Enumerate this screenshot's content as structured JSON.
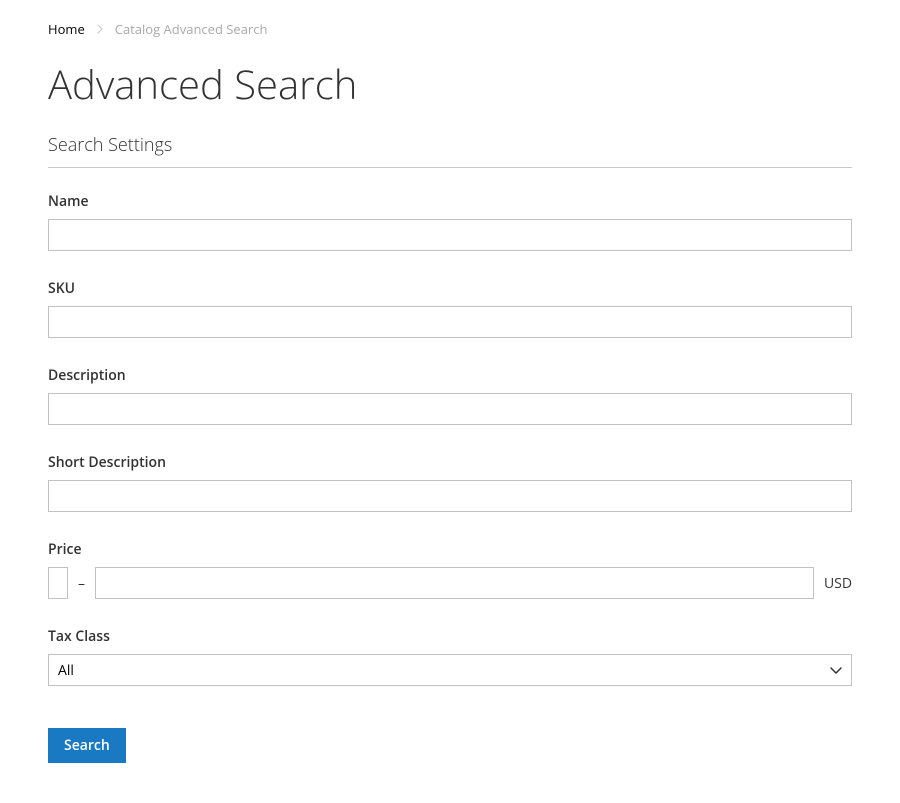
{
  "breadcrumbs": {
    "home": "Home",
    "current": "Catalog Advanced Search"
  },
  "page_title": "Advanced Search",
  "legend": "Search Settings",
  "fields": {
    "name": {
      "label": "Name",
      "value": ""
    },
    "sku": {
      "label": "SKU",
      "value": ""
    },
    "description": {
      "label": "Description",
      "value": ""
    },
    "short_description": {
      "label": "Short Description",
      "value": ""
    },
    "price": {
      "label": "Price",
      "from": "",
      "to": "",
      "separator": "–",
      "currency": "USD"
    },
    "tax_class": {
      "label": "Tax Class",
      "selected": "All"
    }
  },
  "actions": {
    "search": "Search"
  }
}
